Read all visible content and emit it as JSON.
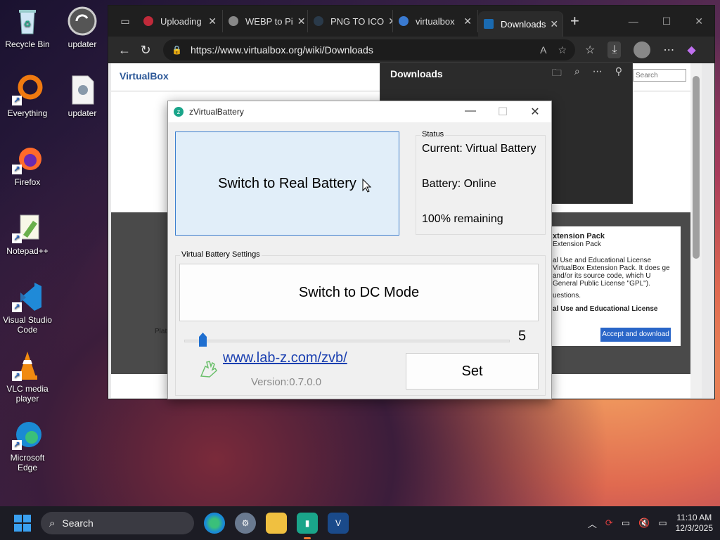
{
  "desktop": {
    "icons": [
      {
        "label": "Recycle Bin"
      },
      {
        "label": "updater"
      },
      {
        "label": "Everything"
      },
      {
        "label": "updater"
      },
      {
        "label": "Firefox"
      },
      {
        "label": "Notepad++"
      },
      {
        "label": "Visual Studio Code"
      },
      {
        "label": "VLC media player"
      },
      {
        "label": "Microsoft Edge"
      }
    ]
  },
  "browser": {
    "tabs": [
      {
        "label": "Uploading"
      },
      {
        "label": "WEBP to Pi"
      },
      {
        "label": "PNG TO ICO"
      },
      {
        "label": "virtualbox"
      },
      {
        "label": "Downloads"
      }
    ],
    "url": "https://www.virtualbox.org/wiki/Downloads",
    "page": {
      "brand": "VirtualBox",
      "search_placeholder": "Search",
      "ext_title": "xtension Pack",
      "ext_sub": "Extension Pack",
      "ext_text": "al Use and Educational License VirtualBox Extension Pack. It does ge and/or its source code, which U General Public License \"GPL\").",
      "ext_q": "uestions.",
      "ext_bold": "al Use and Educational License",
      "accept_label": "Accept and download",
      "platf": "Platf"
    },
    "downloads_panel": {
      "title": "Downloads"
    }
  },
  "zvb": {
    "title": "zVirtualBattery",
    "switch_real_label": "Switch to Real Battery",
    "status_legend": "Status",
    "status_current": "Current: Virtual Battery",
    "status_battery": "Battery: Online",
    "status_remaining": "100% remaining",
    "settings_legend": "Virtual Battery Settings",
    "switch_dc_label": "Switch to DC Mode",
    "slider_value": "5",
    "link": "www.lab-z.com/zvb/",
    "version": "Version:0.7.0.0",
    "set_label": "Set"
  },
  "taskbar": {
    "search_label": "Search",
    "time": "11:10 AM",
    "date": "12/3/2025"
  }
}
